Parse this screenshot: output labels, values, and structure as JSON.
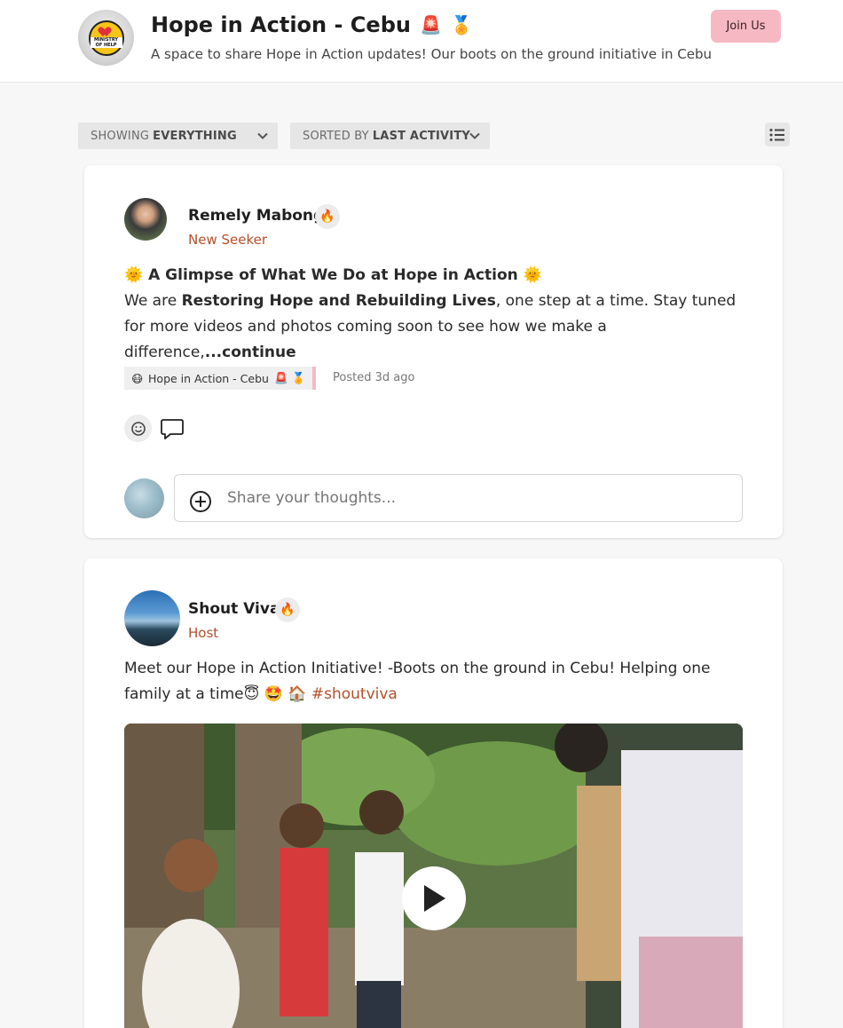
{
  "header": {
    "title": "Hope in Action - Cebu",
    "title_emojis": [
      "🚨",
      "🏅"
    ],
    "description": "A space to share Hope in Action updates! Our boots on the ground initiative in Cebu",
    "join_label": "Join Us",
    "logo_text": "MINISTRY OF HELP"
  },
  "filters": {
    "showing_prefix": "SHOWING",
    "showing_value": "EVERYTHING",
    "sorted_prefix": "SORTED BY",
    "sorted_value": "LAST ACTIVITY"
  },
  "posts": [
    {
      "author": "Remely Mabong",
      "badge": "🔥",
      "role": "New Seeker",
      "title_emoji": "🌞",
      "title": "A Glimpse of What We Do at Hope in Action",
      "body_prefix": "We are ",
      "body_bold": "Restoring Hope and Rebuilding Lives",
      "body_rest": ", one step at a time. Stay tuned for more videos and photos coming soon to see how we make a difference,",
      "continue": "...continue",
      "tag_emoji": "😷",
      "tag": "Hope in Action - Cebu",
      "tag_emojis": "🚨 🏅",
      "posted": "Posted 3d ago",
      "comment_placeholder": "Share your thoughts..."
    },
    {
      "author": "Shout Viva",
      "badge": "🔥",
      "role": "Host",
      "body": "Meet our Hope in Action Initiative! -Boots on the ground in Cebu! Helping one family at a time",
      "body_emojis": "😇 🤩 🏠",
      "hashtag": "#shoutviva"
    }
  ],
  "colors": {
    "accent_pink": "#f6b9c3",
    "role_color": "#b4502b"
  }
}
